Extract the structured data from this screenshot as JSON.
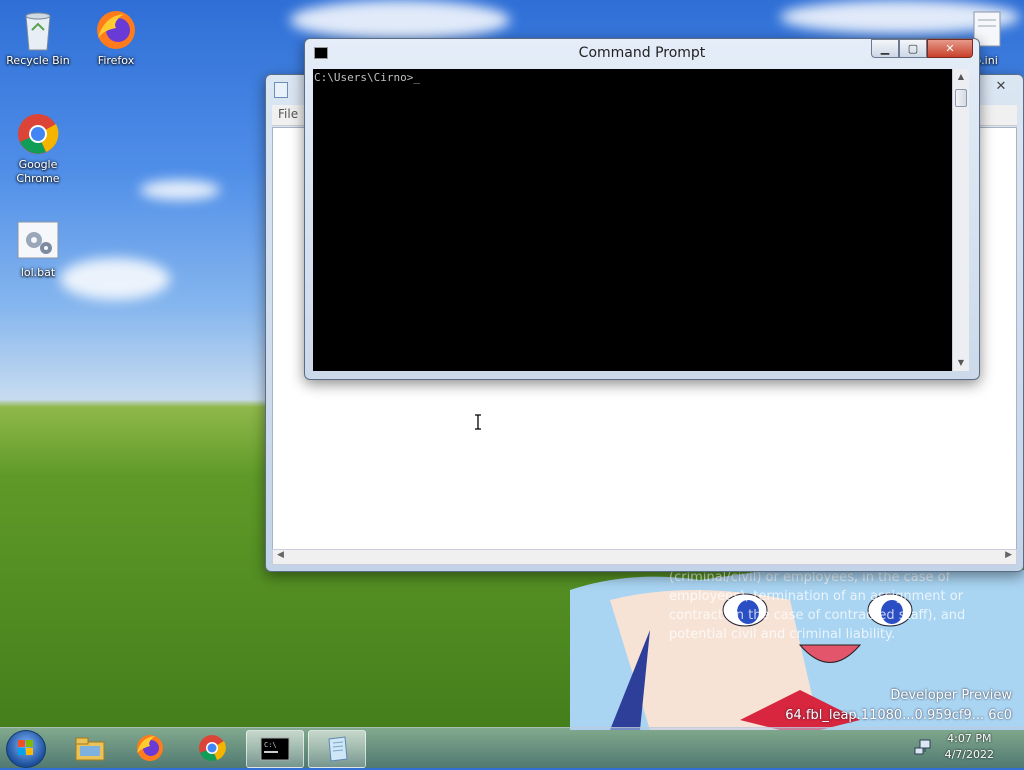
{
  "desktop": {
    "icons": [
      {
        "label": "Recycle Bin",
        "icon": "recycle-bin-icon"
      },
      {
        "label": "Firefox",
        "icon": "firefox-icon"
      },
      {
        "label": "Google Chrome",
        "icon": "chrome-icon"
      },
      {
        "label": "lol.bat",
        "icon": "batch-file-icon"
      },
      {
        "label": "p.ini",
        "icon": "ini-file-icon"
      }
    ],
    "overlay_text": [
      "(criminal/civil) or employees, in the case of",
      "employees), termination of an assignment or",
      "contract (in the case of contracted staff), and",
      "potential civil and criminal liability."
    ],
    "watermark_line1": "Developer Preview",
    "watermark_line2": "64.fbl_leap.11080...0.959cf9... 6c0"
  },
  "cmd": {
    "title": "Command Prompt",
    "prompt": "C:\\Users\\Cirno>",
    "cursor": "_"
  },
  "notepad": {
    "menu_file": "File"
  },
  "taskbar": {
    "time": "4:07 PM",
    "date": "4/7/2022",
    "items": [
      "windows-start-icon",
      "explorer-icon",
      "firefox-icon",
      "chrome-icon",
      "cmd-icon",
      "notepad-icon"
    ]
  }
}
